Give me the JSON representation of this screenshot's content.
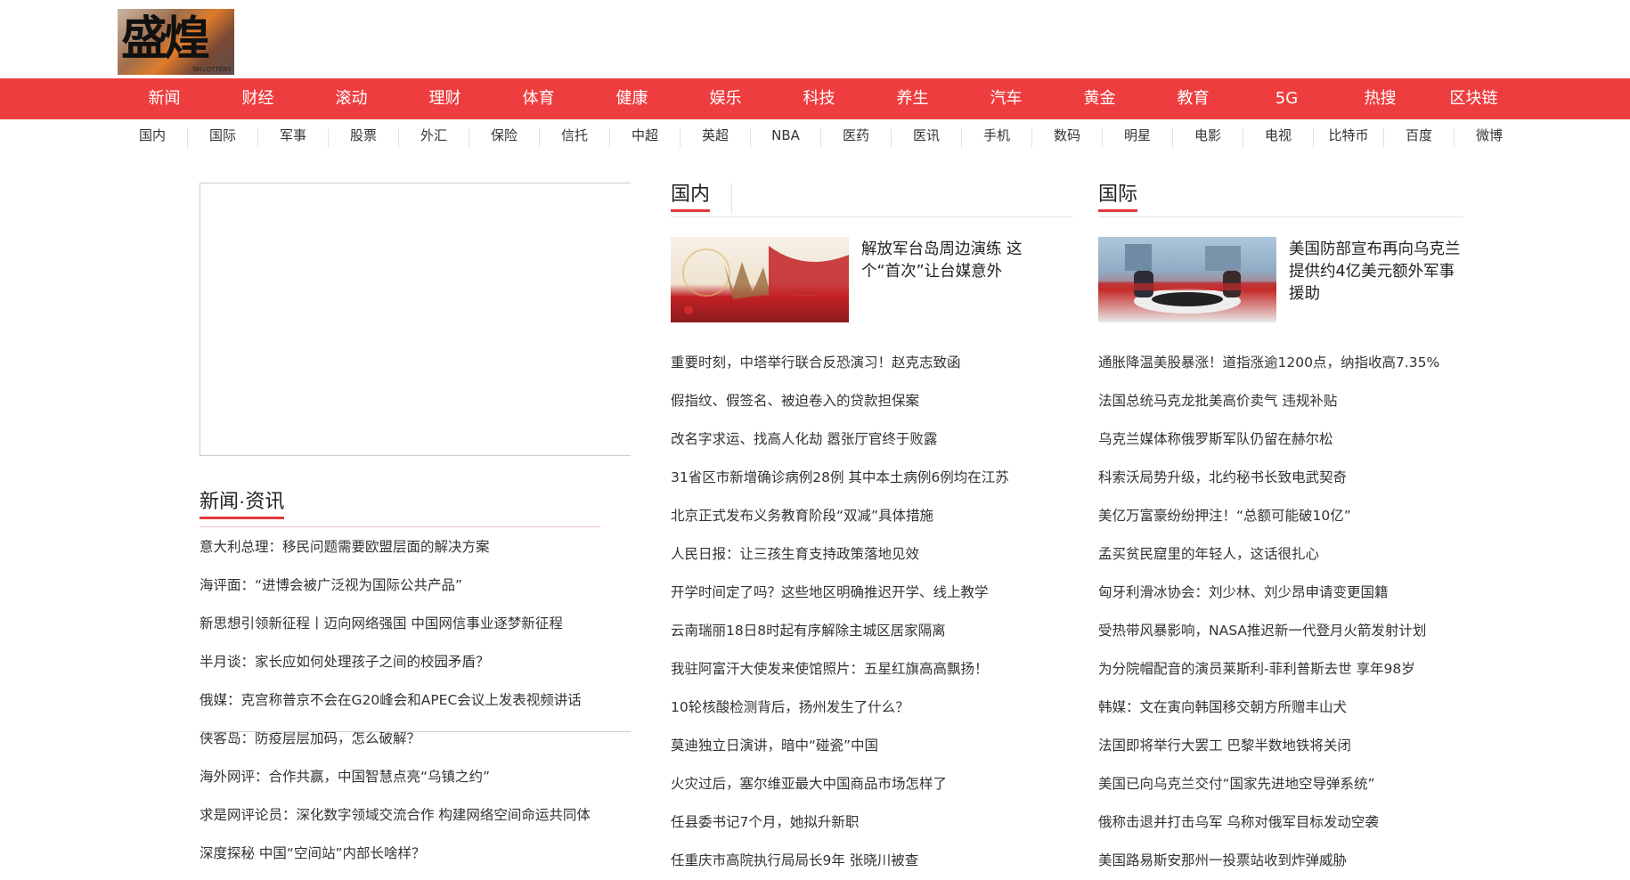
{
  "logo": {
    "text": "盛煌",
    "sub": "SH LOTTERY"
  },
  "main_nav": [
    "新闻",
    "财经",
    "滚动",
    "理财",
    "体育",
    "健康",
    "娱乐",
    "科技",
    "养生",
    "汽车",
    "黄金",
    "教育",
    "5G",
    "热搜",
    "区块链"
  ],
  "sub_nav": [
    "国内",
    "国际",
    "军事",
    "股票",
    "外汇",
    "保险",
    "信托",
    "中超",
    "英超",
    "NBA",
    "医药",
    "医讯",
    "手机",
    "数码",
    "明星",
    "电影",
    "电视",
    "比特币",
    "百度",
    "微博"
  ],
  "left": {
    "title": "新闻·资讯",
    "items": [
      "意大利总理：移民问题需要欧盟层面的解决方案",
      "海评面：“进博会被广泛视为国际公共产品”",
      "新思想引领新征程丨迈向网络强国 中国网信事业逐梦新征程",
      "半月谈：家长应如何处理孩子之间的校园矛盾？",
      "俄媒：克宫称普京不会在G20峰会和APEC会议上发表视频讲话",
      "侠客岛：防疫层层加码，怎么破解？",
      "海外网评：合作共赢，中国智慧点亮“乌镇之约”",
      "求是网评论员：深化数字领域交流合作 构建网络空间命运共同体",
      "深度探秘 中国“空间站”内部长啥样？"
    ]
  },
  "middle": {
    "title": "国内",
    "feature_title": "解放军台岛周边演练 这个“首次”让台媒意外",
    "items": [
      "重要时刻，中塔举行联合反恐演习！赵克志致函",
      "假指纹、假签名、被迫卷入的贷款担保案",
      "改名字求运、找高人化劫 嚣张厅官终于败露",
      "31省区市新增确诊病例28例 其中本土病例6例均在江苏",
      "北京正式发布义务教育阶段“双减”具体措施",
      "人民日报：让三孩生育支持政策落地见效",
      "开学时间定了吗？这些地区明确推迟开学、线上教学",
      "云南瑞丽18日8时起有序解除主城区居家隔离",
      "我驻阿富汗大使发来使馆照片：五星红旗高高飘扬！",
      "10轮核酸检测背后，扬州发生了什么？",
      "莫迪独立日演讲，暗中“碰瓷”中国",
      "火灾过后，塞尔维亚最大中国商品市场怎样了",
      "任县委书记7个月，她拟升新职",
      "任重庆市高院执行局局长9年 张晓川被查"
    ]
  },
  "right": {
    "title": "国际",
    "feature_title": "美国防部宣布再向乌克兰提供约4亿美元额外军事援助",
    "items": [
      "通胀降温美股暴涨！道指涨逾1200点，纳指收高7.35%",
      "法国总统马克龙批美高价卖气 违规补贴",
      "乌克兰媒体称俄罗斯军队仍留在赫尔松",
      "科索沃局势升级，北约秘书长致电武契奇",
      "美亿万富豪纷纷押注！“总额可能破10亿”",
      "孟买贫民窟里的年轻人，这话很扎心",
      "匈牙利滑冰协会：刘少林、刘少昂申请变更国籍",
      "受热带风暴影响，NASA推迟新一代登月火箭发射计划",
      "为分院帽配音的演员莱斯利-菲利普斯去世 享年98岁",
      "韩媒：文在寅向韩国移交朝方所赠丰山犬",
      "法国即将举行大罢工 巴黎半数地铁将关闭",
      "美国已向乌克兰交付“国家先进地空导弹系统”",
      "俄称击退并打击乌军 乌称对俄军目标发动空袭",
      "美国路易斯安那州一投票站收到炸弹威胁"
    ]
  },
  "colors": {
    "accent": "#ee3d3f",
    "underline": "#e23a3c"
  }
}
